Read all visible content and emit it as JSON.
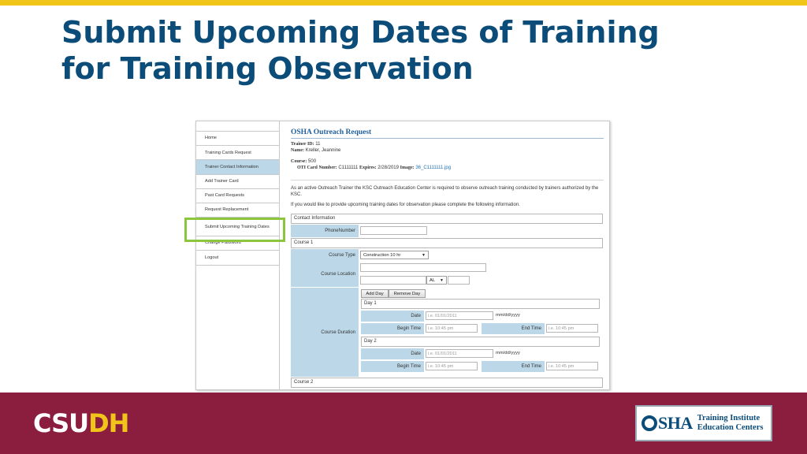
{
  "slide": {
    "title_line1": "Submit Upcoming Dates of Training",
    "title_line2": "for Training Observation",
    "brand": {
      "csu": "CSU",
      "dh": "DH"
    },
    "osha_logo": {
      "mark": "OSHA",
      "line1": "Training Institute",
      "line2": "Education Centers"
    },
    "colors": {
      "top_bar": "#f0c419",
      "title": "#0b4c79",
      "footer": "#8b1e3f",
      "highlight": "#8cc63f"
    }
  },
  "sidebar": {
    "items": [
      {
        "label": "Home"
      },
      {
        "label": "Training Cards Request"
      },
      {
        "label": "Trainer Contact Information"
      },
      {
        "label": "Add Trainer Card"
      },
      {
        "label": "Past Card Requests"
      },
      {
        "label": "Request Replacement"
      },
      {
        "label": "Submit Upcoming Training Dates"
      },
      {
        "label": "Change Password"
      },
      {
        "label": "Logout"
      }
    ]
  },
  "request": {
    "title": "OSHA Outreach Request",
    "trainer_id_label": "Trainer ID:",
    "trainer_id": "11",
    "name_label": "Name:",
    "name": "Kreller, Jeannine",
    "course_label": "Course:",
    "course": "500",
    "oti_label": "OTI Card Number:",
    "oti": "C1111111",
    "expires_label": "Expires:",
    "expires": "2/28/2019",
    "image_label": "Image:",
    "image": "36_C1111111.jpg",
    "para1": "As an active Outreach Trainer the KSC Outreach Education Center is required to observe outreach training conducted by trainers authorized by the KSC.",
    "para2": "If you would like to provide upcoming training dates for observation please complete the following information."
  },
  "form": {
    "contact_section": "Contact Information",
    "phone_label": "PhoneNumber",
    "course1_section": "Course 1",
    "course_type_label": "Course Type",
    "course_type_value": "Construction 10 hr",
    "course_location_label": "Course Location",
    "state_value": "AL",
    "course_duration_label": "Course Duration",
    "add_day": "Add Day",
    "remove_day": "Remove Day",
    "days": [
      {
        "label": "Day 1",
        "date_label": "Date",
        "date_placeholder": "i.e. 01/01/2011",
        "date_format": "mm/dd/yyyy",
        "begin_label": "Begin Time",
        "begin_placeholder": "i.e. 10:45 pm",
        "end_label": "End Time",
        "end_placeholder": "i.e. 10:45 pm"
      },
      {
        "label": "Day 2",
        "date_label": "Date",
        "date_placeholder": "i.e. 01/01/2011",
        "date_format": "mm/dd/yyyy",
        "begin_label": "Begin Time",
        "begin_placeholder": "i.e. 10:45 pm",
        "end_label": "End Time",
        "end_placeholder": "i.e. 10:45 pm"
      }
    ],
    "course2_section": "Course 2"
  }
}
